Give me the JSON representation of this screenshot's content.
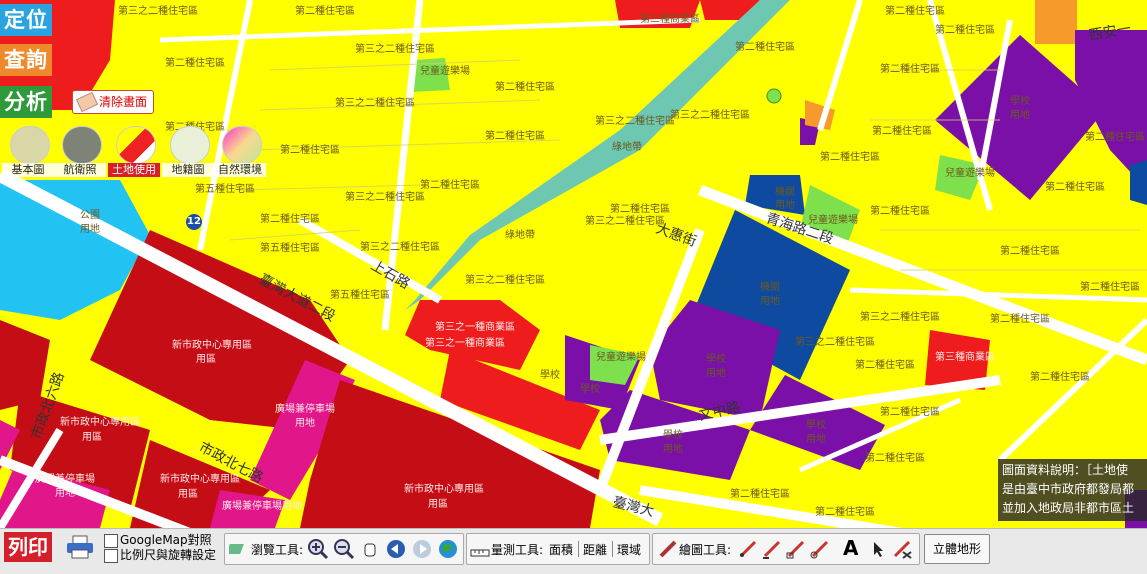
{
  "sidebar": {
    "locate": "定位",
    "query": "查詢",
    "analyze": "分析",
    "clear": "清除畫面"
  },
  "layers": [
    {
      "label": "基本圖",
      "icon": "basemap-icon"
    },
    {
      "label": "航衛照",
      "icon": "aerial-photo-icon"
    },
    {
      "label": "土地使用",
      "icon": "land-use-icon",
      "active": true
    },
    {
      "label": "地籍圖",
      "icon": "cadastral-icon"
    },
    {
      "label": "自然環境",
      "icon": "natural-environment-icon"
    }
  ],
  "route_shield": "12",
  "map": {
    "roads": {
      "taiwan_blvd": "臺灣大道二段",
      "qinghai_rd": "青海路二段",
      "shizheng_n7": "市政北七路",
      "shizheng_n6": "市政北六路",
      "wenxin_rd": "文中路",
      "shangshi_rd": "上石路",
      "dahui_st": "大惠街",
      "yuanan": "西安一",
      "taiwan_blvd_bottom": "臺灣大"
    },
    "zones": {
      "res2": "第二種住宅區",
      "res32": "第三之二種住宅區",
      "res5": "第五種住宅區",
      "com3": "第三種商業區",
      "com32": "第三之一種商業區",
      "green": "綠地帶",
      "school": "學校",
      "use": "用地",
      "park": "公園",
      "park_use": "公園用地",
      "school_use": "學校用地",
      "utility": "機關",
      "utility_use": "機關用地",
      "kids_park": "兒童遊樂場",
      "civic_center": "新市政中心專用區",
      "parking": "廣場兼停車場",
      "parking_use": "廣場兼停車場用地",
      "civic_center2": "新市政中心專用區",
      "zone_area": "用區"
    }
  },
  "infobox": {
    "line1": "圖面資料說明：［土地使",
    "line2": "是由臺中市政府都發局都",
    "line3": "並加入地政局非都市區土"
  },
  "toolbar": {
    "print": "列印",
    "googlemap": "GoogleMap對照",
    "rotate": "比例尺與旋轉設定",
    "browse_label": "瀏覽工具:",
    "measure_label": "量測工具:",
    "measure_area": "面積",
    "measure_distance": "距離",
    "measure_ring": "環域",
    "draw_label": "繪圖工具:",
    "draw_text": "A",
    "terrain": "立體地形"
  },
  "colors": {
    "residential": "#ffff00",
    "commercial": "#ee1c1c",
    "civic": "#c40d15",
    "school": "#7a10a8",
    "utility": "#0d4aa0",
    "park": "#22c3f2",
    "green": "#7ee04c",
    "parking": "#e0168a",
    "road": "#ffffff"
  }
}
